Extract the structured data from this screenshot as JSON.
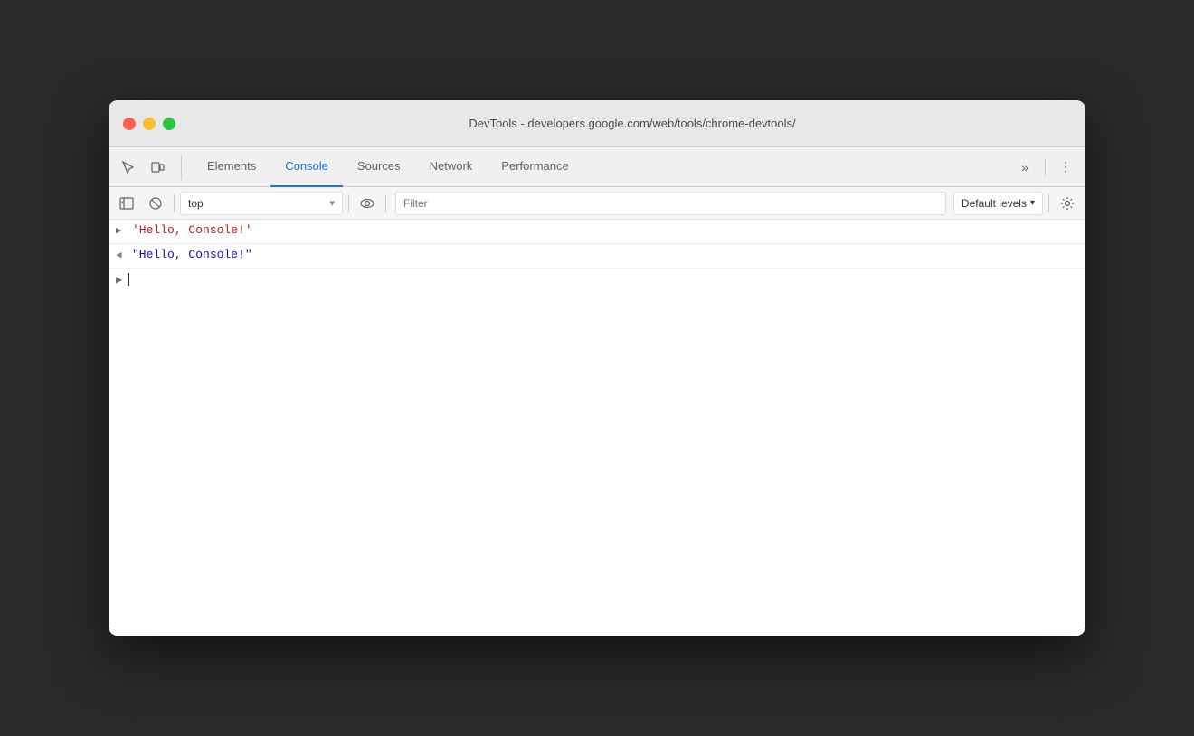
{
  "window": {
    "title": "DevTools - developers.google.com/web/tools/chrome-devtools/"
  },
  "tabs": [
    {
      "id": "elements",
      "label": "Elements",
      "active": false
    },
    {
      "id": "console",
      "label": "Console",
      "active": true
    },
    {
      "id": "sources",
      "label": "Sources",
      "active": false
    },
    {
      "id": "network",
      "label": "Network",
      "active": false
    },
    {
      "id": "performance",
      "label": "Performance",
      "active": false
    }
  ],
  "toolbar": {
    "context": "top",
    "filter_placeholder": "Filter",
    "default_levels": "Default levels"
  },
  "console": {
    "entries": [
      {
        "type": "log",
        "arrow": "▶",
        "text": "'Hello, Console!'"
      },
      {
        "type": "result",
        "arrow": "◀",
        "text": "\"Hello, Console!\""
      }
    ],
    "prompt": ">"
  },
  "icons": {
    "inspect": "↖",
    "device": "⊡",
    "more": "⋮",
    "sidebar": "▤",
    "clear": "⊘",
    "dropdown": "▾",
    "eye": "◉",
    "gear": "⚙"
  }
}
